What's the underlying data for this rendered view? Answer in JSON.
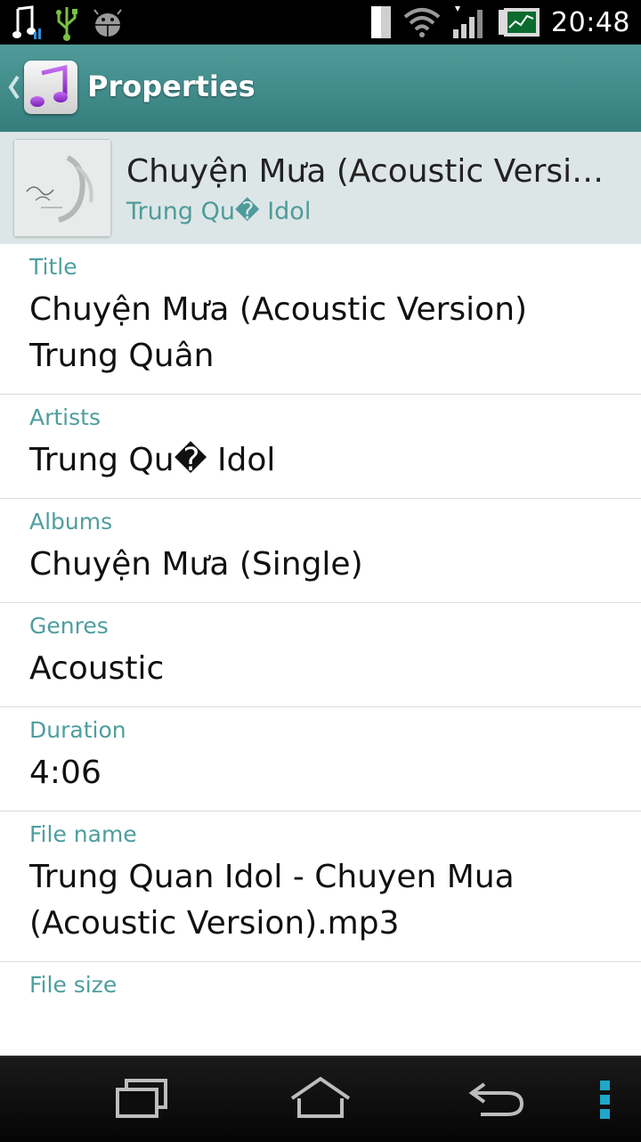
{
  "status_bar": {
    "time": "20:48",
    "icons": [
      "music-note-icon",
      "usb-icon",
      "android-debug-icon",
      "sim-card-icon",
      "wifi-icon",
      "signal-icon",
      "battery-icon"
    ]
  },
  "action_bar": {
    "title": "Properties",
    "app_icon": "music-note-icon",
    "accent": "#3f8d8c"
  },
  "song_header": {
    "title": "Chuyện Mưa (Acoustic Versi…",
    "artist": "Trung Qu� Idol"
  },
  "properties": [
    {
      "label": "Title",
      "value": "Chuyện Mưa (Acoustic Version) Trung Quân"
    },
    {
      "label": "Artists",
      "value": "Trung Qu� Idol"
    },
    {
      "label": "Albums",
      "value": "Chuyện Mưa (Single)"
    },
    {
      "label": "Genres",
      "value": "Acoustic"
    },
    {
      "label": "Duration",
      "value": "4:06"
    },
    {
      "label": "File name",
      "value": "Trung Quan Idol - Chuyen Mua (Acoustic Version).mp3"
    },
    {
      "label": "File size",
      "value": ""
    }
  ],
  "nav_bar": {
    "buttons": [
      "recent-apps-icon",
      "home-icon",
      "back-icon",
      "overflow-menu-icon"
    ]
  },
  "colors": {
    "label_teal": "#4f9e9e",
    "header_bg": "#dde6e6"
  }
}
